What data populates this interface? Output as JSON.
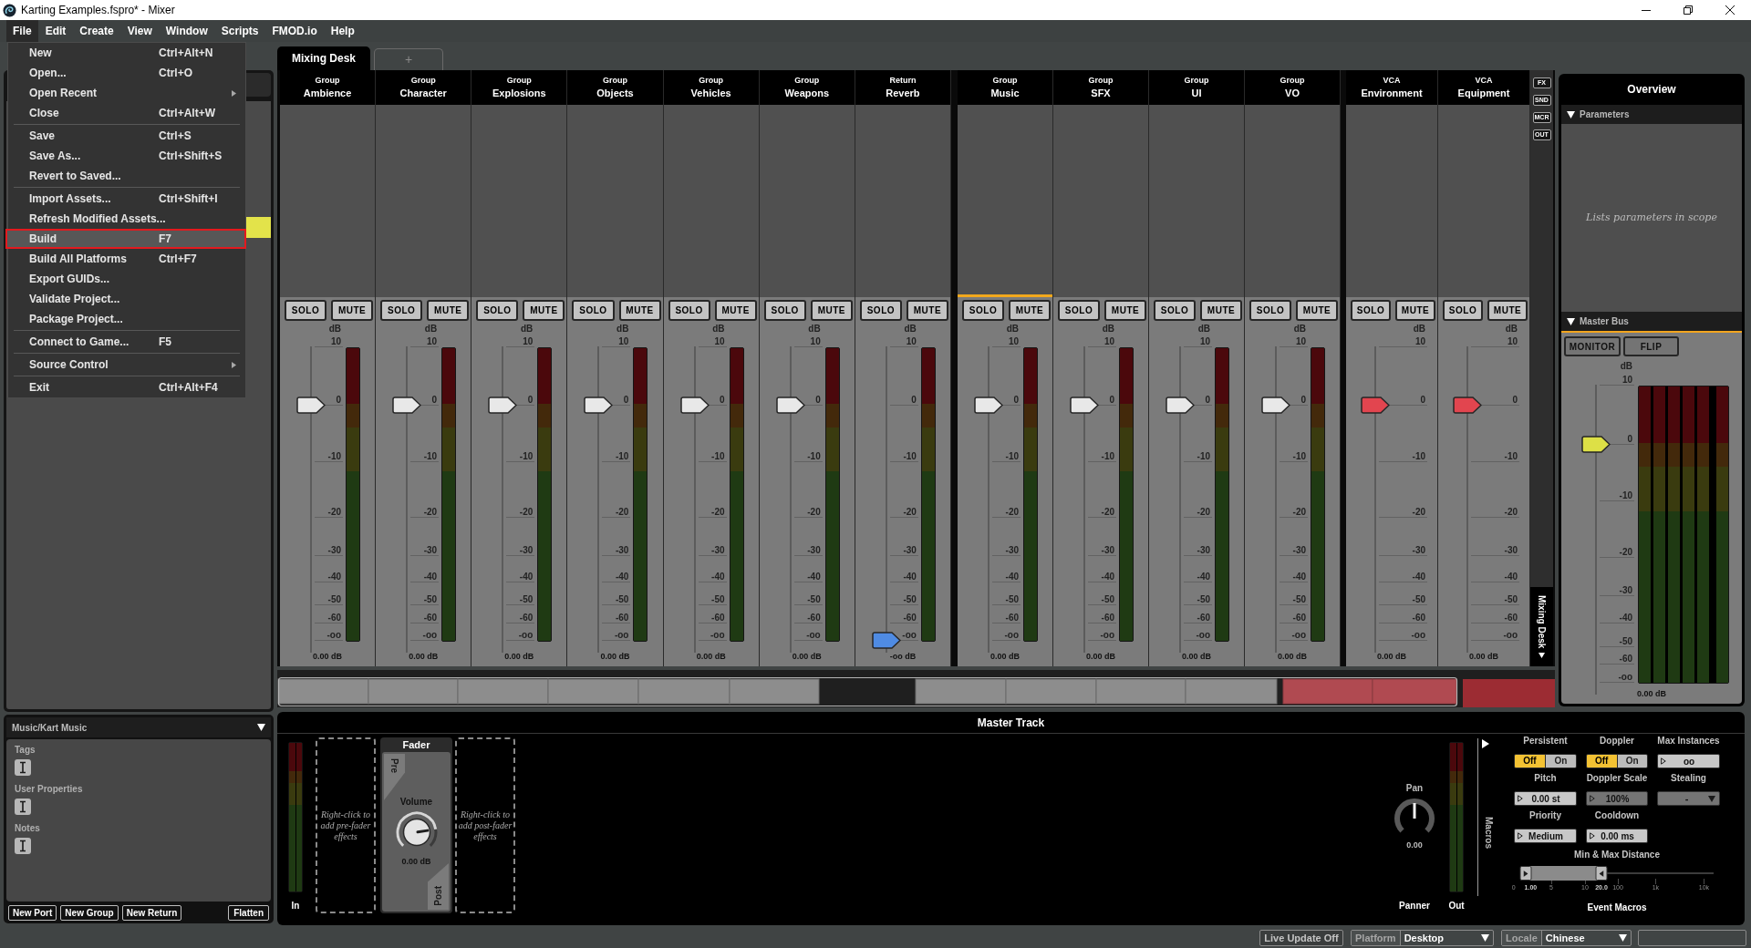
{
  "window": {
    "title": "Karting Examples.fspro* - Mixer"
  },
  "menu_bar": [
    {
      "label": "File",
      "selected": true
    },
    {
      "label": "Edit",
      "selected": false
    },
    {
      "label": "Create",
      "selected": false
    },
    {
      "label": "View",
      "selected": false
    },
    {
      "label": "Window",
      "selected": false
    },
    {
      "label": "Scripts",
      "selected": false
    },
    {
      "label": "FMOD.io",
      "selected": false
    },
    {
      "label": "Help",
      "selected": false
    }
  ],
  "file_menu": {
    "sections": [
      {
        "items": [
          {
            "label": "New",
            "shortcut": "Ctrl+Alt+N",
            "submenu": false,
            "selected": false
          },
          {
            "label": "Open...",
            "shortcut": "Ctrl+O",
            "submenu": false,
            "selected": false
          },
          {
            "label": "Open Recent",
            "submenu": true,
            "selected": false
          },
          {
            "label": "Close",
            "shortcut": "Ctrl+Alt+W",
            "submenu": false,
            "selected": false
          }
        ]
      },
      {
        "items": [
          {
            "label": "Save",
            "shortcut": "Ctrl+S",
            "submenu": false,
            "selected": false
          },
          {
            "label": "Save As...",
            "shortcut": "Ctrl+Shift+S",
            "submenu": false,
            "selected": false
          },
          {
            "label": "Revert to Saved...",
            "submenu": false,
            "selected": false
          }
        ]
      },
      {
        "items": [
          {
            "label": "Import Assets...",
            "shortcut": "Ctrl+Shift+I",
            "submenu": false,
            "selected": false
          },
          {
            "label": "Refresh Modified Assets...",
            "submenu": false,
            "selected": false
          },
          {
            "label": "Build",
            "shortcut": "F7",
            "submenu": false,
            "selected": true
          },
          {
            "label": "Build All Platforms",
            "shortcut": "Ctrl+F7",
            "submenu": false,
            "selected": false
          },
          {
            "label": "Export GUIDs...",
            "submenu": false,
            "selected": false
          },
          {
            "label": "Validate Project...",
            "submenu": false,
            "selected": false
          },
          {
            "label": "Package Project...",
            "submenu": false,
            "selected": false
          }
        ]
      },
      {
        "items": [
          {
            "label": "Connect to Game...",
            "shortcut": "F5",
            "submenu": false,
            "selected": false
          }
        ]
      },
      {
        "items": [
          {
            "label": "Source Control",
            "submenu": true,
            "selected": false
          }
        ]
      },
      {
        "items": [
          {
            "label": "Exit",
            "shortcut": "Ctrl+Alt+F4",
            "submenu": false,
            "selected": false
          }
        ]
      }
    ]
  },
  "browser": {
    "rows": [
      {
        "selected": false
      },
      {
        "selected": false
      },
      {
        "selected": false
      },
      {
        "selected": false
      },
      {
        "selected": false
      },
      {
        "selected": true
      }
    ]
  },
  "properties": {
    "title": "Music/Kart Music",
    "fields": [
      {
        "label": "Tags"
      },
      {
        "label": "User Properties"
      },
      {
        "label": "Notes"
      }
    ],
    "buttons": [
      "New Port",
      "New Group",
      "New Return"
    ],
    "flatten": "Flatten"
  },
  "mixer": {
    "tabs": [
      {
        "label": "Mixing Desk",
        "selected": true
      },
      {
        "label": "+",
        "selected": false
      }
    ],
    "sections": [
      {
        "strips": [
          {
            "kind": "group",
            "type": "Group",
            "name": "Ambience",
            "selected": false,
            "solo": "SOLO",
            "mute": "MUTE",
            "unit": "dB",
            "scale": [
              "10",
              "0",
              "-10",
              "-20",
              "-30",
              "-40",
              "-50",
              "-60",
              "-oo"
            ],
            "level": 0.8,
            "value": "0.00 dB"
          },
          {
            "kind": "group",
            "type": "Group",
            "name": "Character",
            "selected": false,
            "solo": "SOLO",
            "mute": "MUTE",
            "unit": "dB",
            "scale": [
              "10",
              "0",
              "-10",
              "-20",
              "-30",
              "-40",
              "-50",
              "-60",
              "-oo"
            ],
            "level": 0.8,
            "value": "0.00 dB"
          },
          {
            "kind": "group",
            "type": "Group",
            "name": "Explosions",
            "selected": false,
            "solo": "SOLO",
            "mute": "MUTE",
            "unit": "dB",
            "scale": [
              "10",
              "0",
              "-10",
              "-20",
              "-30",
              "-40",
              "-50",
              "-60",
              "-oo"
            ],
            "level": 0.8,
            "value": "0.00 dB"
          },
          {
            "kind": "group",
            "type": "Group",
            "name": "Objects",
            "selected": false,
            "solo": "SOLO",
            "mute": "MUTE",
            "unit": "dB",
            "scale": [
              "10",
              "0",
              "-10",
              "-20",
              "-30",
              "-40",
              "-50",
              "-60",
              "-oo"
            ],
            "level": 0.8,
            "value": "0.00 dB"
          },
          {
            "kind": "group",
            "type": "Group",
            "name": "Vehicles",
            "selected": false,
            "solo": "SOLO",
            "mute": "MUTE",
            "unit": "dB",
            "scale": [
              "10",
              "0",
              "-10",
              "-20",
              "-30",
              "-40",
              "-50",
              "-60",
              "-oo"
            ],
            "level": 0.8,
            "value": "0.00 dB"
          },
          {
            "kind": "group",
            "type": "Group",
            "name": "Weapons",
            "selected": false,
            "solo": "SOLO",
            "mute": "MUTE",
            "unit": "dB",
            "scale": [
              "10",
              "0",
              "-10",
              "-20",
              "-30",
              "-40",
              "-50",
              "-60",
              "-oo"
            ],
            "level": 0.8,
            "value": "0.00 dB"
          },
          {
            "kind": "return",
            "type": "Return",
            "name": "Reverb",
            "selected": false,
            "solo": "SOLO",
            "mute": "MUTE",
            "unit": "dB",
            "scale": [
              "10",
              "0",
              "-10",
              "-20",
              "-30",
              "-40",
              "-50",
              "-60",
              "-oo"
            ],
            "level": 0,
            "value": "-oo dB"
          }
        ]
      },
      {
        "strips": [
          {
            "kind": "group",
            "type": "Group",
            "name": "Music",
            "selected": true,
            "solo": "SOLO",
            "mute": "MUTE",
            "unit": "dB",
            "scale": [
              "10",
              "0",
              "-10",
              "-20",
              "-30",
              "-40",
              "-50",
              "-60",
              "-oo"
            ],
            "level": 0.8,
            "value": "0.00 dB"
          },
          {
            "kind": "group",
            "type": "Group",
            "name": "SFX",
            "selected": false,
            "solo": "SOLO",
            "mute": "MUTE",
            "unit": "dB",
            "scale": [
              "10",
              "0",
              "-10",
              "-20",
              "-30",
              "-40",
              "-50",
              "-60",
              "-oo"
            ],
            "level": 0.8,
            "value": "0.00 dB"
          },
          {
            "kind": "group",
            "type": "Group",
            "name": "UI",
            "selected": false,
            "solo": "SOLO",
            "mute": "MUTE",
            "unit": "dB",
            "scale": [
              "10",
              "0",
              "-10",
              "-20",
              "-30",
              "-40",
              "-50",
              "-60",
              "-oo"
            ],
            "level": 0.8,
            "value": "0.00 dB"
          },
          {
            "kind": "group",
            "type": "Group",
            "name": "VO",
            "selected": false,
            "solo": "SOLO",
            "mute": "MUTE",
            "unit": "dB",
            "scale": [
              "10",
              "0",
              "-10",
              "-20",
              "-30",
              "-40",
              "-50",
              "-60",
              "-oo"
            ],
            "level": 0.8,
            "value": "0.00 dB"
          }
        ]
      },
      {
        "strips": [
          {
            "kind": "vca",
            "type": "VCA",
            "name": "Environment",
            "selected": false,
            "solo": "SOLO",
            "mute": "MUTE",
            "unit": "dB",
            "scale": [
              "10",
              "0",
              "-10",
              "-20",
              "-30",
              "-40",
              "-50",
              "-60",
              "-oo"
            ],
            "level": 0.8,
            "value": "0.00 dB"
          },
          {
            "kind": "vca",
            "type": "VCA",
            "name": "Equipment",
            "selected": false,
            "solo": "SOLO",
            "mute": "MUTE",
            "unit": "dB",
            "scale": [
              "10",
              "0",
              "-10",
              "-20",
              "-30",
              "-40",
              "-50",
              "-60",
              "-oo"
            ],
            "level": 0.8,
            "value": "0.00 dB"
          }
        ]
      }
    ],
    "side_buttons": [
      "FX",
      "SND",
      "MCR",
      "OUT"
    ],
    "side_label": "Mixing Desk"
  },
  "overview": {
    "title": "Overview",
    "parameters": {
      "label": "Parameters",
      "expanded": true,
      "empty_text": "Lists parameters in scope"
    },
    "master_bus": {
      "label": "Master Bus",
      "expanded": true,
      "buttons": [
        "MONITOR",
        "FLIP"
      ],
      "kind": "master",
      "unit": "dB",
      "scale": [
        "10",
        "0",
        "-10",
        "-20",
        "-30",
        "-40",
        "-50",
        "-60",
        "-oo"
      ],
      "level": 0.8,
      "value": "0.00 dB"
    }
  },
  "master_track": {
    "title": "Master Track",
    "input_label": "In",
    "pre_hint": "Right-click to add pre-fader effects",
    "fader": {
      "title": "Fader",
      "pre": "Pre",
      "post": "Post",
      "label": "Volume",
      "level": 0.8,
      "value": "0.00 dB"
    },
    "post_hint": "Right-click to add post-fader effects",
    "pan": {
      "label": "Pan",
      "level": 0.5,
      "value": "0.00",
      "caption": "Panner"
    },
    "output_label": "Out",
    "macros": {
      "label": "Macros",
      "title": "Event Macros",
      "controls": [
        {
          "kind": "toggle",
          "label": "Persistent",
          "disabled": false,
          "options": [
            {
              "label": "Off",
              "selected": true
            },
            {
              "label": "On",
              "selected": false
            }
          ]
        },
        {
          "kind": "toggle",
          "label": "Doppler",
          "disabled": false,
          "options": [
            {
              "label": "Off",
              "selected": true
            },
            {
              "label": "On",
              "selected": false
            }
          ]
        },
        {
          "kind": "field",
          "label": "Max Instances",
          "value": "oo",
          "disabled": false
        },
        {
          "kind": "field",
          "label": "Pitch",
          "value": "0.00 st",
          "disabled": false
        },
        {
          "kind": "field",
          "label": "Doppler Scale",
          "value": "100%",
          "disabled": true
        },
        {
          "kind": "dropdown",
          "label": "Stealing",
          "value": "-",
          "disabled": true
        },
        {
          "kind": "field",
          "label": "Priority",
          "value": "Medium",
          "disabled": false
        },
        {
          "kind": "field",
          "label": "Cooldown",
          "value": "0.00 ms",
          "disabled": false
        }
      ],
      "distance": {
        "label": "Min & Max Distance",
        "handles": [
          {
            "level": 0.03,
            "value": "1.00"
          },
          {
            "level": 0.42,
            "value": "20.0"
          }
        ],
        "ticks": [
          "0",
          "5",
          "10",
          "100",
          "1k",
          "10k"
        ]
      }
    }
  },
  "status_bar": {
    "live_update": "Live Update Off",
    "platform": {
      "label": "Platform",
      "value": "Desktop"
    },
    "locale": {
      "label": "Locale",
      "value": "Chinese"
    }
  }
}
